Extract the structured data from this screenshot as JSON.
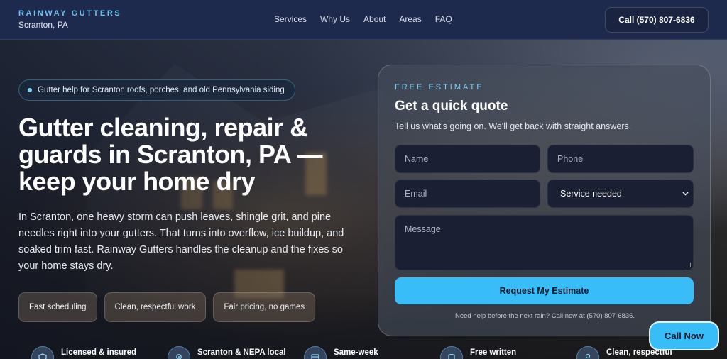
{
  "header": {
    "brand_name": "RAINWAY GUTTERS",
    "brand_city": "Scranton, PA",
    "nav": [
      "Services",
      "Why Us",
      "About",
      "Areas",
      "FAQ"
    ],
    "call_label": "Call (570) 807-6836"
  },
  "hero": {
    "pill": "Gutter help for Scranton roofs, porches, and old Pennsylvania siding",
    "title": "Gutter cleaning, repair & guards in Scranton, PA — keep your home dry",
    "lead": "In Scranton, one heavy storm can push leaves, shingle grit, and pine needles right into your gutters. That turns into overflow, ice buildup, and soaked trim fast. Rainway Gutters handles the cleanup and the fixes so your home stays dry.",
    "features": [
      "Fast scheduling",
      "Clean, respectful work",
      "Fair pricing, no games"
    ],
    "badges": [
      {
        "icon": "shield-icon",
        "label": "Licensed & insured"
      },
      {
        "icon": "location-pin-icon",
        "label": "Scranton & NEPA local"
      },
      {
        "icon": "calendar-icon",
        "label": "Same-week"
      },
      {
        "icon": "clipboard-icon",
        "label": "Free written"
      },
      {
        "icon": "person-icon",
        "label": "Clean, respectful"
      }
    ]
  },
  "quote": {
    "eyebrow": "FREE ESTIMATE",
    "title": "Get a quick quote",
    "subtitle": "Tell us what's going on. We'll get back with straight answers.",
    "name_placeholder": "Name",
    "phone_placeholder": "Phone",
    "email_placeholder": "Email",
    "service_selected": "Service needed",
    "message_placeholder": "Message",
    "submit_label": "Request My Estimate",
    "help_text": "Need help before the next rain? Call now at (570) 807-6836."
  },
  "floating": {
    "call_now": "Call Now"
  },
  "colors": {
    "accent": "#38bdf8",
    "header_bg": "#1d2a4d",
    "field_bg": "#1b1f33"
  }
}
